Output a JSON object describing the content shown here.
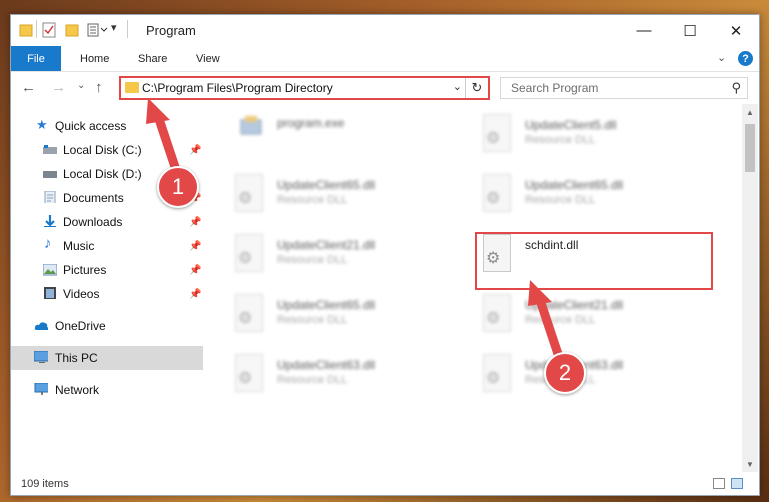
{
  "window": {
    "title": "Program",
    "controls": {
      "minimize": "—",
      "maximize": "☐",
      "close": "✕"
    }
  },
  "ribbon": {
    "tabs": [
      "File",
      "Home",
      "Share",
      "View"
    ],
    "help": "?"
  },
  "nav": {
    "address": "C:\\Program Files\\Program Directory",
    "search_placeholder": "Search Program"
  },
  "sidebar": {
    "items": [
      {
        "label": "Quick access",
        "icon": "star-icon",
        "pinned": false
      },
      {
        "label": "Local Disk (C:)",
        "icon": "drive-icon",
        "pinned": true
      },
      {
        "label": "Local Disk (D:)",
        "icon": "drive-icon",
        "pinned": false
      },
      {
        "label": "Documents",
        "icon": "documents-icon",
        "pinned": true
      },
      {
        "label": "Downloads",
        "icon": "download-icon",
        "pinned": true
      },
      {
        "label": "Music",
        "icon": "music-icon",
        "pinned": true
      },
      {
        "label": "Pictures",
        "icon": "pictures-icon",
        "pinned": true
      },
      {
        "label": "Videos",
        "icon": "videos-icon",
        "pinned": true
      },
      {
        "label": "OneDrive",
        "icon": "cloud-icon",
        "pinned": false
      },
      {
        "label": "This PC",
        "icon": "computer-icon",
        "pinned": false,
        "selected": true
      },
      {
        "label": "Network",
        "icon": "network-icon",
        "pinned": false
      }
    ]
  },
  "files": [
    {
      "name": "program.exe",
      "type": ""
    },
    {
      "name": "UpdateClient5.dll",
      "type": "Resource DLL"
    },
    {
      "name": "UpdateClient65.dll",
      "type": "Resource DLL"
    },
    {
      "name": "UpdateClient65.dll",
      "type": "Resource DLL"
    },
    {
      "name": "UpdateClient21.dll",
      "type": "Resource DLL"
    },
    {
      "name": "schdint.dll",
      "type": ""
    },
    {
      "name": "UpdateClient65.dll",
      "type": "Resource DLL"
    },
    {
      "name": "UpdateClient21.dll",
      "type": "Resource DLL"
    },
    {
      "name": "UpdateClient63.dll",
      "type": "Resource DLL"
    },
    {
      "name": "UpdateClient63.dll",
      "type": "Resource DLL"
    }
  ],
  "status": {
    "item_count": "109 items"
  },
  "callouts": [
    "1",
    "2"
  ],
  "colors": {
    "accent": "#1979ca",
    "highlight": "#e24848",
    "selected": "#d9d9d9"
  }
}
